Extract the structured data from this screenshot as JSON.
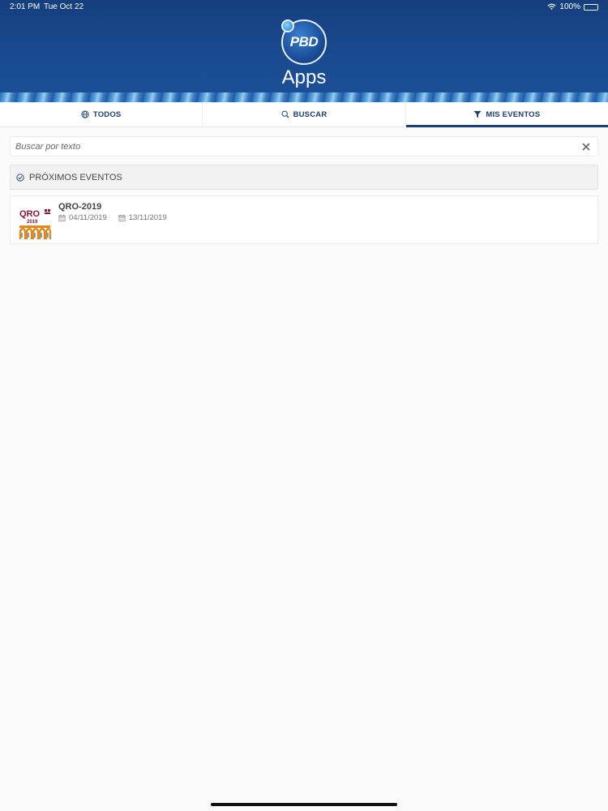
{
  "status_bar": {
    "time": "2:01 PM",
    "date": "Tue Oct 22",
    "battery": "100%"
  },
  "header": {
    "logo_text": "PBD",
    "app_title": "Apps"
  },
  "tabs": [
    {
      "label": "TODOS",
      "icon": "globe-icon",
      "active": false
    },
    {
      "label": "BUSCAR",
      "icon": "search-icon",
      "active": false
    },
    {
      "label": "MIS EVENTOS",
      "icon": "filter-icon",
      "active": true
    }
  ],
  "search": {
    "placeholder": "Buscar por texto",
    "value": ""
  },
  "section": {
    "title": "PRÓXIMOS EVENTOS",
    "icon": "check-circle-icon"
  },
  "events": [
    {
      "name": "QRO-2019",
      "start_date": "04/11/2019",
      "end_date": "13/11/2019",
      "thumb_text": "QRO",
      "thumb_year": "2019"
    }
  ],
  "colors": {
    "header_blue": "#1a4b91",
    "tab_text": "#1d3f73",
    "thumb_red": "#8b1538",
    "thumb_orange": "#e08a1e"
  }
}
